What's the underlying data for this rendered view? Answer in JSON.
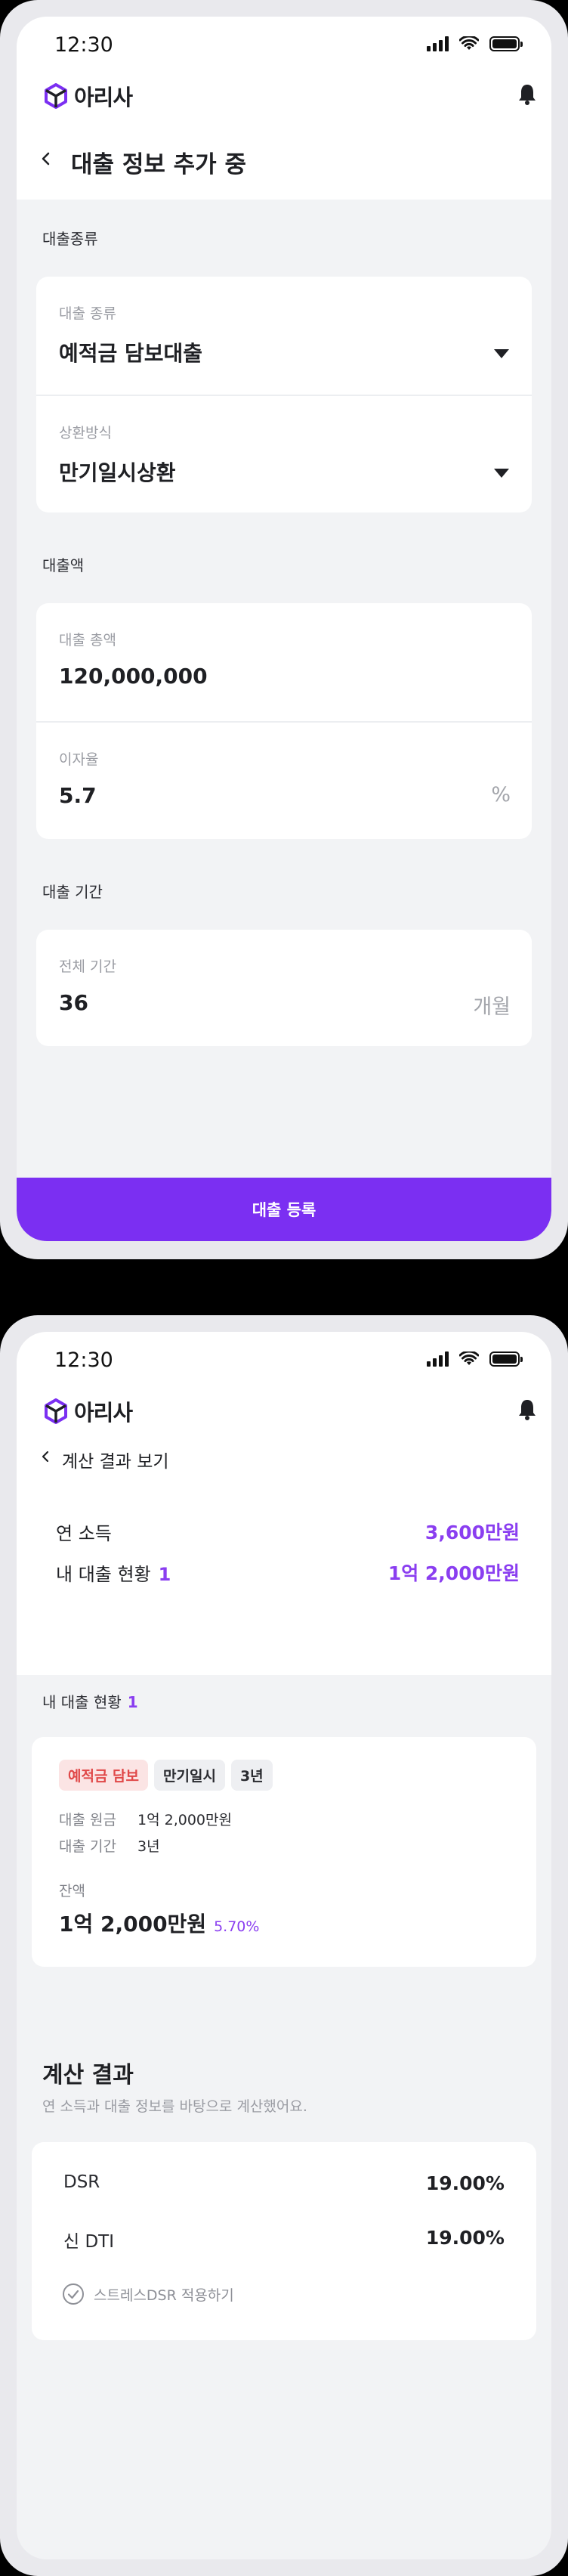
{
  "screen1": {
    "status_time": "12:30",
    "logo_text": "아리사",
    "title": "대출 정보 추가 중",
    "sections": {
      "loan_type": {
        "label": "대출종류",
        "fields": [
          {
            "label": "대출 종류",
            "value": "예적금 담보대출"
          },
          {
            "label": "상환방식",
            "value": "만기일시상환"
          }
        ]
      },
      "amount": {
        "label": "대출액",
        "fields": [
          {
            "label": "대출 총액",
            "value": "120,000,000"
          },
          {
            "label": "이자율",
            "value": "5.7",
            "unit": "%"
          }
        ]
      },
      "period": {
        "label": "대출 기간",
        "fields": [
          {
            "label": "전체 기간",
            "value": "36",
            "unit": "개월"
          }
        ]
      }
    },
    "cta": "대출 등록"
  },
  "screen2": {
    "status_time": "12:30",
    "logo_text": "아리사",
    "title": "계산 결과 보기",
    "summary": {
      "income_label": "연 소득",
      "income_value": "3,600만원",
      "loans_label": "내 대출 현황",
      "loans_count": "1",
      "loans_value": "1억 2,000만원"
    },
    "loans_section": {
      "label": "내 대출 현황",
      "count": "1",
      "card": {
        "chips": [
          "예적금 담보",
          "만기일시",
          "3년"
        ],
        "principal_label": "대출 원금",
        "principal_value": "1억 2,000만원",
        "period_label": "대출 기간",
        "period_value": "3년",
        "balance_label": "잔액",
        "balance_value": "1억 2,000만원",
        "rate": "5.70%"
      }
    },
    "result": {
      "title": "계산 결과",
      "subtitle": "연 소득과 대출 정보를 바탕으로 계산했어요.",
      "rows": [
        {
          "label": "DSR",
          "value": "19.00%"
        },
        {
          "label": "신 DTI",
          "value": "19.00%"
        }
      ],
      "stress_label": "스트레스DSR 적용하기"
    }
  },
  "colors": {
    "accent": "#7b2ff2",
    "danger": "#e04848",
    "background": "#f2f3f5"
  }
}
